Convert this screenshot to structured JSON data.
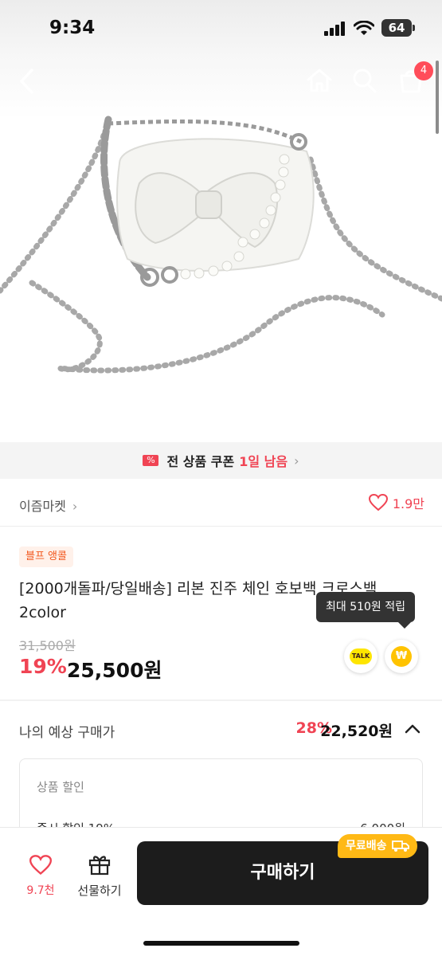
{
  "status_bar": {
    "time": "9:34",
    "battery": "64"
  },
  "nav": {
    "cart_count": "4"
  },
  "coupon_banner": {
    "text": "전 상품 쿠폰",
    "highlight": "1일 남음"
  },
  "store": {
    "name": "이즘마켓",
    "like_count": "1.9만"
  },
  "product": {
    "badge": "블프 앵콜",
    "title": "[2000개돌파/당일배송] 리본 진주 체인 호보백 크로스백 2color",
    "original_price": "31,500원",
    "discount_rate": "19%",
    "sale_price": "25,500원",
    "tooltip": "최대 510원 적립",
    "talk_label": "TALK",
    "point_symbol": "₩"
  },
  "expected_price": {
    "label": "나의 예상 구매가",
    "rate": "28%",
    "price": "22,520원"
  },
  "discount_box": {
    "title": "상품 할인",
    "row_label": "즉시 할인 19%",
    "row_value": "6,000원"
  },
  "bottom_bar": {
    "like_count": "9.7천",
    "gift_label": "선물하기",
    "buy_label": "구매하기",
    "free_shipping": "무료배송"
  },
  "colors": {
    "accent": "#f04454",
    "buy_button": "#1c1c1c",
    "free_shipping": "#ffb915"
  }
}
